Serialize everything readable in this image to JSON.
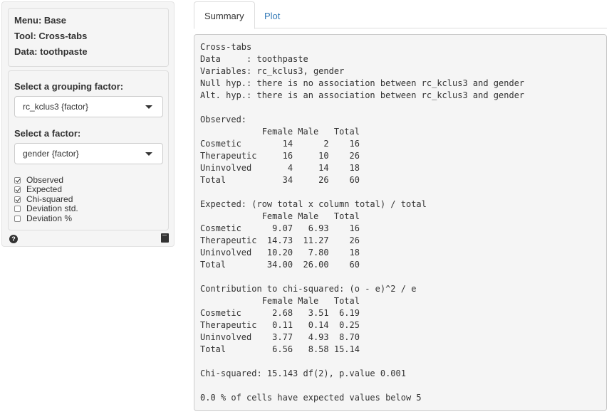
{
  "sidebar": {
    "info": {
      "menu": "Menu: Base",
      "tool": "Tool: Cross-tabs",
      "data": "Data: toothpaste"
    },
    "grouping_label": "Select a grouping factor:",
    "grouping_value": "rc_kclus3 {factor}",
    "factor_label": "Select a factor:",
    "factor_value": "gender {factor}",
    "checks": [
      {
        "label": "Observed",
        "checked": true
      },
      {
        "label": "Expected",
        "checked": true
      },
      {
        "label": "Chi-squared",
        "checked": true
      },
      {
        "label": "Deviation std.",
        "checked": false
      },
      {
        "label": "Deviation %",
        "checked": false
      }
    ],
    "help_icon": "question-circle-icon",
    "report_icon": "book-icon"
  },
  "tabs": [
    {
      "label": "Summary",
      "active": true
    },
    {
      "label": "Plot",
      "active": false
    }
  ],
  "colors": {
    "link": "#337ab7",
    "well_bg": "#f5f5f5",
    "text": "#333333"
  },
  "output": {
    "lines": [
      "Cross-tabs",
      "Data     : toothpaste",
      "Variables: rc_kclus3, gender",
      "Null hyp.: there is no association between rc_kclus3 and gender",
      "Alt. hyp.: there is an association between rc_kclus3 and gender",
      "",
      "Observed:",
      "            Female Male   Total",
      "Cosmetic        14      2    16",
      "Therapeutic     16     10    26",
      "Uninvolved       4     14    18",
      "Total           34     26    60",
      "",
      "Expected: (row total x column total) / total",
      "            Female Male   Total",
      "Cosmetic      9.07   6.93    16",
      "Therapeutic  14.73  11.27    26",
      "Uninvolved   10.20   7.80    18",
      "Total        34.00  26.00    60",
      "",
      "Contribution to chi-squared: (o - e)^2 / e",
      "            Female Male   Total",
      "Cosmetic      2.68   3.51  6.19",
      "Therapeutic   0.11   0.14  0.25",
      "Uninvolved    3.77   4.93  8.70",
      "Total         6.56   8.58 15.14",
      "",
      "Chi-squared: 15.143 df(2), p.value 0.001",
      "",
      "0.0 % of cells have expected values below 5"
    ]
  }
}
